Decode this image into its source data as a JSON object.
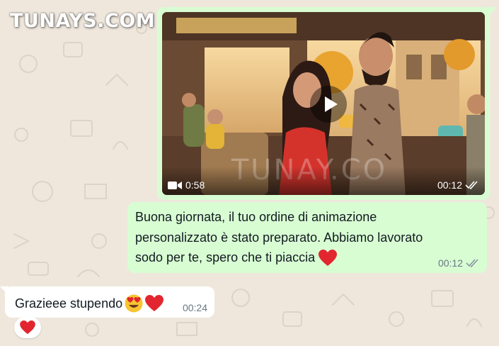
{
  "watermark": {
    "text": "TUNAYS.COM"
  },
  "video_message": {
    "thumbnail_overlay": "TUNAY.CO",
    "duration": "0:58",
    "time": "00:12",
    "status_icon": "double-check-icon",
    "play_icon": "play-icon",
    "video_icon": "video-camera-icon"
  },
  "text_message_out": {
    "lines": [
      "Buona giornata, il tuo ordine di animazione",
      "personalizzato è stato preparato. Abbiamo lavorato",
      "sodo per te, spero che ti piaccia"
    ],
    "emoji_icon": "red-heart-icon",
    "time": "00:12",
    "status_icon": "double-check-icon"
  },
  "text_message_in": {
    "text": "Grazieee stupendo",
    "emoji_icons": [
      "heart-eyes-face-icon",
      "red-heart-icon"
    ],
    "time": "00:24"
  },
  "reaction": {
    "icon": "red-heart-icon"
  },
  "colors": {
    "outgoing_bubble": "#d9fdd3",
    "incoming_bubble": "#ffffff",
    "chat_background": "#efe7dc",
    "meta_text": "#667781",
    "heart": "#e2262f"
  }
}
